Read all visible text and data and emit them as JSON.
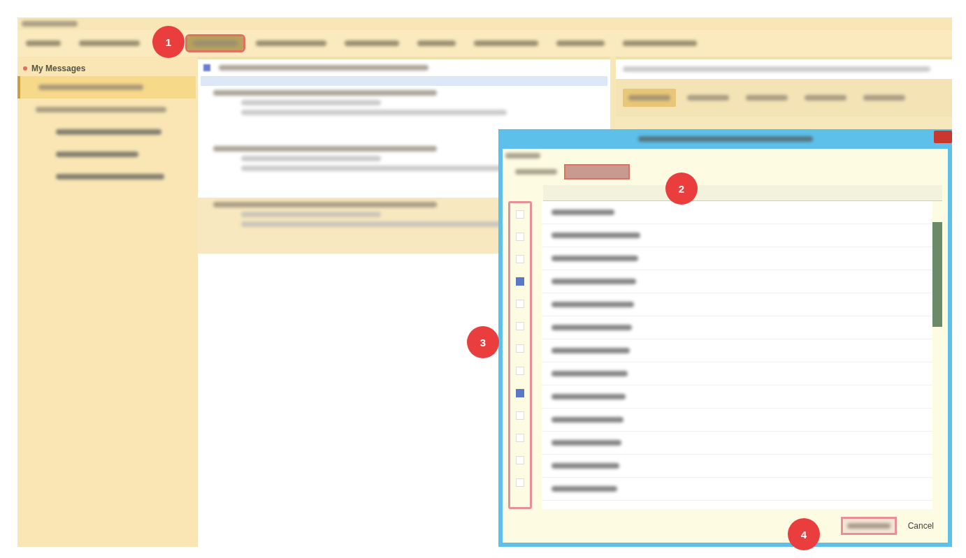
{
  "toolbar": {
    "items": [
      {
        "selected": false
      },
      {
        "selected": false
      },
      {
        "selected": true
      },
      {
        "selected": false
      },
      {
        "selected": false
      },
      {
        "selected": false
      },
      {
        "selected": false
      },
      {
        "selected": false
      },
      {
        "selected": false
      }
    ]
  },
  "sidebar": {
    "title": "My Messages",
    "items": [
      {
        "selected": true
      },
      {
        "selected": false,
        "children": [
          {
            "selected": false
          },
          {
            "selected": false
          },
          {
            "selected": false
          }
        ]
      }
    ]
  },
  "messages": [
    {
      "selected": false
    },
    {
      "selected": false
    },
    {
      "selected": true
    }
  ],
  "detail": {
    "tabs": [
      {
        "selected": true
      },
      {
        "selected": false
      },
      {
        "selected": false
      },
      {
        "selected": false
      },
      {
        "selected": false
      }
    ]
  },
  "dialog": {
    "rows": [
      {
        "checked": false
      },
      {
        "checked": false
      },
      {
        "checked": false
      },
      {
        "checked": true
      },
      {
        "checked": false
      },
      {
        "checked": false
      },
      {
        "checked": false
      },
      {
        "checked": false
      },
      {
        "checked": true
      },
      {
        "checked": false
      },
      {
        "checked": false
      },
      {
        "checked": false
      },
      {
        "checked": false
      }
    ],
    "cancel": "Cancel"
  },
  "callouts": [
    "1",
    "2",
    "3",
    "4"
  ]
}
